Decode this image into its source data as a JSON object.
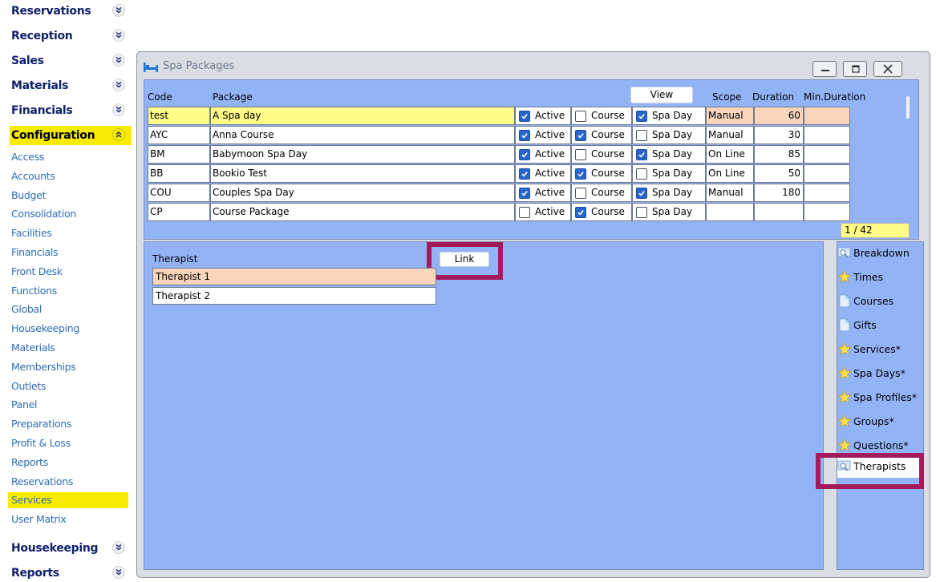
{
  "sidebar": {
    "sections_top": [
      "Reservations",
      "Reception",
      "Sales",
      "Materials",
      "Financials",
      "Configuration"
    ],
    "active_section": "Configuration",
    "config_items": [
      "Access",
      "Accounts",
      "Budget",
      "Consolidation",
      "Facilities",
      "Financials",
      "Front Desk",
      "Functions",
      "Global",
      "Housekeeping",
      "Materials",
      "Memberships",
      "Outlets",
      "Panel",
      "Preparations",
      "Profit & Loss",
      "Reports",
      "Reservations",
      "Services",
      "User Matrix"
    ],
    "selected_item": "Services",
    "sections_bottom": [
      "Housekeeping",
      "Reports"
    ]
  },
  "window": {
    "title": "Spa Packages"
  },
  "grid": {
    "headers": {
      "code": "Code",
      "package": "Package",
      "view": "View",
      "scope": "Scope",
      "duration": "Duration",
      "min_duration": "Min.Duration"
    },
    "rows": [
      {
        "code": "test",
        "package": "A Spa day",
        "active": true,
        "course": false,
        "spa_day": true,
        "scope": "Manual",
        "duration": "60",
        "min_duration": "",
        "selected": true
      },
      {
        "code": "AYC",
        "package": "Anna Course",
        "active": true,
        "course": true,
        "spa_day": false,
        "scope": "Manual",
        "duration": "30",
        "min_duration": "",
        "selected": false
      },
      {
        "code": "BM",
        "package": "Babymoon Spa Day",
        "active": true,
        "course": false,
        "spa_day": true,
        "scope": "On Line",
        "duration": "85",
        "min_duration": "",
        "selected": false
      },
      {
        "code": "BB",
        "package": "Bookio Test",
        "active": true,
        "course": true,
        "spa_day": false,
        "scope": "On Line",
        "duration": "50",
        "min_duration": "",
        "selected": false
      },
      {
        "code": "COU",
        "package": "Couples Spa Day",
        "active": true,
        "course": false,
        "spa_day": true,
        "scope": "Manual",
        "duration": "180",
        "min_duration": "",
        "selected": false
      },
      {
        "code": "CP",
        "package": "Course Package",
        "active": false,
        "course": true,
        "spa_day": false,
        "scope": "",
        "duration": "",
        "min_duration": "",
        "selected": false
      }
    ],
    "checkbox_labels": {
      "active": "Active",
      "course": "Course",
      "spa_day": "Spa Day"
    },
    "counter": "1 / 42"
  },
  "therapists": {
    "header": "Therapist",
    "link_label": "Link",
    "rows": [
      "Therapist 1",
      "Therapist 2"
    ]
  },
  "side_tabs": [
    {
      "label": "Breakdown",
      "icon": "search-icon",
      "active": false
    },
    {
      "label": "Times",
      "icon": "star-icon",
      "active": false
    },
    {
      "label": "Courses",
      "icon": "page-icon",
      "active": false
    },
    {
      "label": "Gifts",
      "icon": "page-icon",
      "active": false
    },
    {
      "label": "Services*",
      "icon": "star-icon",
      "active": false
    },
    {
      "label": "Spa Days*",
      "icon": "star-icon",
      "active": false
    },
    {
      "label": "Spa Profiles*",
      "icon": "star-icon",
      "active": false
    },
    {
      "label": "Groups*",
      "icon": "star-icon",
      "active": false
    },
    {
      "label": "Questions*",
      "icon": "star-icon",
      "active": false
    },
    {
      "label": "Therapists",
      "icon": "search-icon",
      "active": true
    }
  ],
  "colors": {
    "nav_heading": "#10216b",
    "nav_link": "#2e6db5",
    "highlight_yellow": "#f7ec00",
    "panel_blue": "#92b4f7",
    "selection_peach": "#fcd5bd",
    "selection_yellow": "#fffb86",
    "annotation_magenta": "#a41b5b",
    "checkbox_blue": "#2a66c9"
  }
}
